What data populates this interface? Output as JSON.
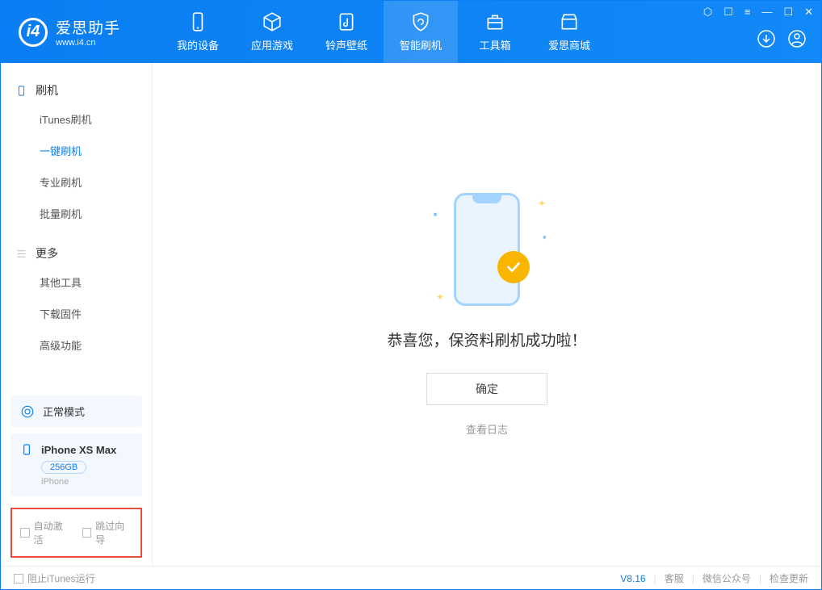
{
  "app": {
    "name": "爱思助手",
    "url": "www.i4.cn"
  },
  "nav": {
    "mydevice": "我的设备",
    "apps": "应用游戏",
    "ringtones": "铃声壁纸",
    "flash": "智能刷机",
    "toolbox": "工具箱",
    "store": "爱思商城"
  },
  "sidebar": {
    "group1": "刷机",
    "items1": [
      "iTunes刷机",
      "一键刷机",
      "专业刷机",
      "批量刷机"
    ],
    "group2": "更多",
    "items2": [
      "其他工具",
      "下载固件",
      "高级功能"
    ]
  },
  "device": {
    "mode": "正常模式",
    "name": "iPhone XS Max",
    "storage": "256GB",
    "type": "iPhone"
  },
  "options": {
    "autoActivate": "自动激活",
    "skipGuide": "跳过向导"
  },
  "main": {
    "successText": "恭喜您，保资料刷机成功啦！",
    "okButton": "确定",
    "viewLog": "查看日志"
  },
  "footer": {
    "blockItunes": "阻止iTunes运行",
    "version": "V8.16",
    "support": "客服",
    "wechat": "微信公众号",
    "update": "检查更新"
  }
}
